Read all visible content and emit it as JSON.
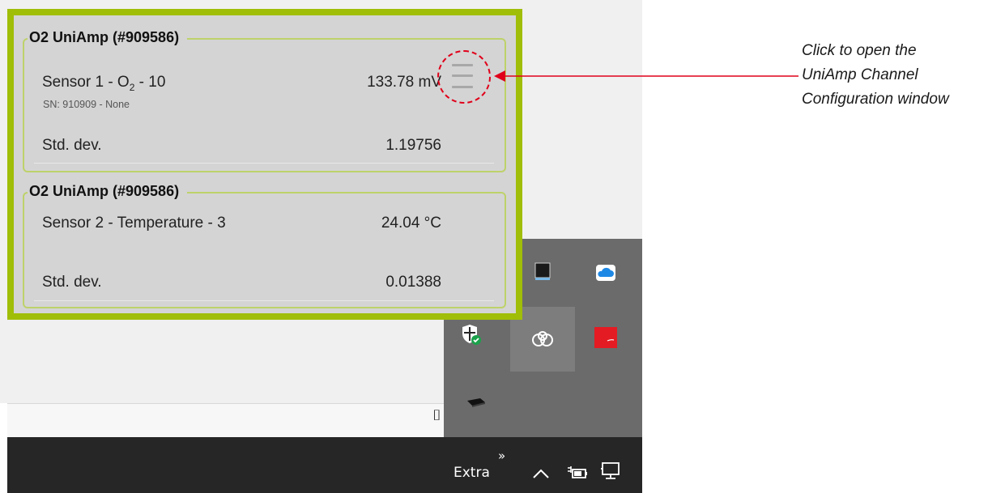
{
  "widget": {
    "channel1": {
      "group_title": "O2 UniAmp (#909586)",
      "sensor_name_prefix": "Sensor 1 - O",
      "sensor_name_subscript": "2",
      "sensor_name_suffix": " - 10",
      "serial_line": "SN: 910909 - None",
      "value": "133.78 mV",
      "stddev_label": "Std. dev.",
      "stddev_value": "1.19756"
    },
    "channel2": {
      "group_title": "O2 UniAmp (#909586)",
      "sensor_name": "Sensor 2 - Temperature - 3",
      "value": "24.04 °C",
      "stddev_label": "Std. dev.",
      "stddev_value": "0.01388"
    },
    "menu_icon": "hamburger-menu-icon"
  },
  "annotation": {
    "lines": [
      "Click to open the",
      "UniAmp Channel",
      "Configuration window"
    ],
    "color": "#e0001a"
  },
  "taskbar": {
    "extra_label": "Extra",
    "overflow_glyph": "»",
    "show_hidden_glyph": "^"
  },
  "tray_icons": [
    "display-icon",
    "cloud-icon",
    "defender-shield-icon",
    "uniamp-tray-icon",
    "red-app-icon",
    "usb-drive-icon"
  ],
  "colors": {
    "widget_border": "#a0be08",
    "widget_bg": "#d4d4d4",
    "group_border": "#bdd26a",
    "taskbar": "#262626",
    "tray_flyout": "#6b6b6b"
  }
}
